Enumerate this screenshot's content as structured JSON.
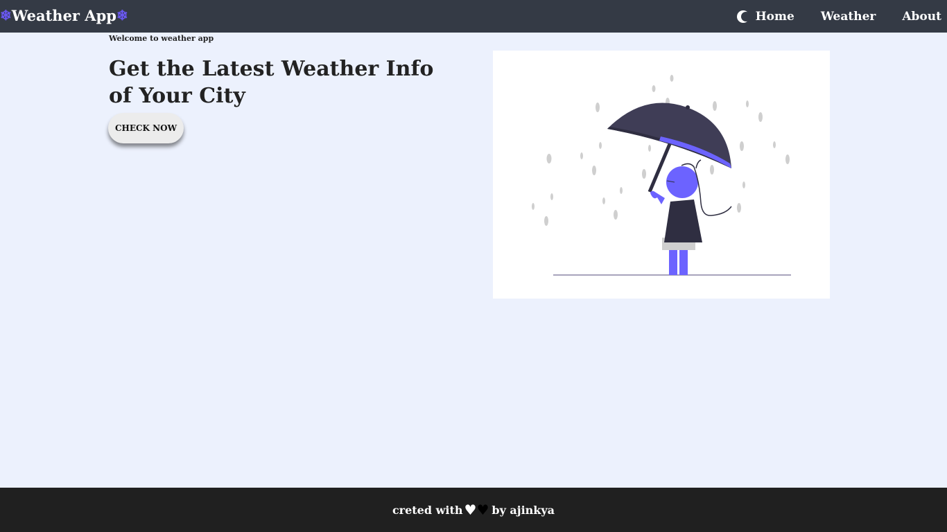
{
  "navbar": {
    "brand": "Weather App",
    "brand_icon": "snowflake-icon",
    "accent_color": "#6a58f1",
    "theme_icon": "moon-icon",
    "links": [
      "Home",
      "Weather",
      "About"
    ]
  },
  "hero": {
    "subtitle": "Welcome to weather app",
    "headline": "Get the Latest Weather Info of Your City",
    "cta": "CHECK NOW",
    "illustration_icon": "girl-with-umbrella-in-rain-icon"
  },
  "footer": {
    "text_before": "creted with",
    "hearts": [
      "white-heart-icon",
      "black-heart-icon"
    ],
    "text_after": "by ajinkya"
  }
}
